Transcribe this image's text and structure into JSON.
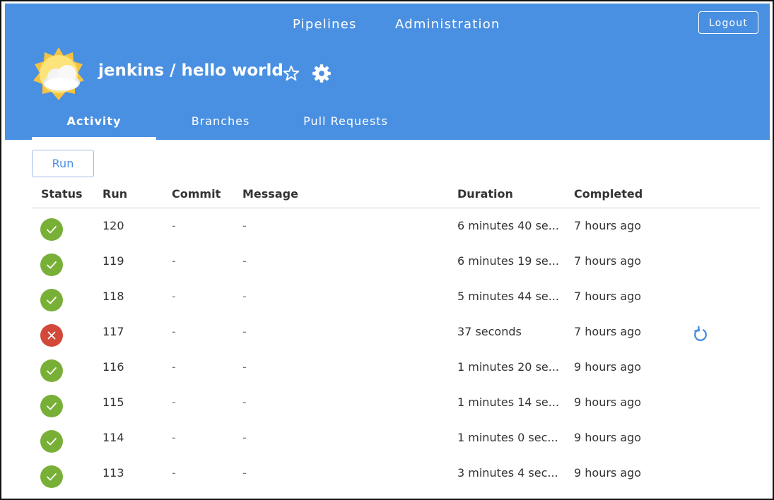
{
  "nav": {
    "pipelines": "Pipelines",
    "administration": "Administration",
    "logout": "Logout"
  },
  "pipeline": {
    "title": "jenkins / hello world"
  },
  "tabs": [
    {
      "label": "Activity"
    },
    {
      "label": "Branches"
    },
    {
      "label": "Pull Requests"
    }
  ],
  "actions": {
    "run_label": "Run"
  },
  "table": {
    "columns": [
      "Status",
      "Run",
      "Commit",
      "Message",
      "Duration",
      "Completed"
    ],
    "rows": [
      {
        "status": "success",
        "run": "120",
        "commit": "-",
        "message": "-",
        "duration": "6 minutes 40 se...",
        "completed": "7 hours ago"
      },
      {
        "status": "success",
        "run": "119",
        "commit": "-",
        "message": "-",
        "duration": "6 minutes 19 se...",
        "completed": "7 hours ago"
      },
      {
        "status": "success",
        "run": "118",
        "commit": "-",
        "message": "-",
        "duration": "5 minutes 44 se...",
        "completed": "7 hours ago"
      },
      {
        "status": "failure",
        "run": "117",
        "commit": "-",
        "message": "-",
        "duration": "37 seconds",
        "completed": "7 hours ago"
      },
      {
        "status": "success",
        "run": "116",
        "commit": "-",
        "message": "-",
        "duration": "1 minutes 20 se...",
        "completed": "9 hours ago"
      },
      {
        "status": "success",
        "run": "115",
        "commit": "-",
        "message": "-",
        "duration": "1 minutes 14 se...",
        "completed": "9 hours ago"
      },
      {
        "status": "success",
        "run": "114",
        "commit": "-",
        "message": "-",
        "duration": "1 minutes 0 sec...",
        "completed": "9 hours ago"
      },
      {
        "status": "success",
        "run": "113",
        "commit": "-",
        "message": "-",
        "duration": "3 minutes 4 sec...",
        "completed": "9 hours ago"
      }
    ]
  },
  "colors": {
    "header": "#4a90e2",
    "success": "#78b037",
    "failure": "#d24939",
    "accent": "#4a90e2"
  },
  "icons": {
    "weather": "weather-partly-sunny-icon",
    "star": "star-outline-icon",
    "gear": "gear-icon",
    "success": "check-circle-icon",
    "failure": "x-circle-icon",
    "rerun": "rerun-icon"
  }
}
